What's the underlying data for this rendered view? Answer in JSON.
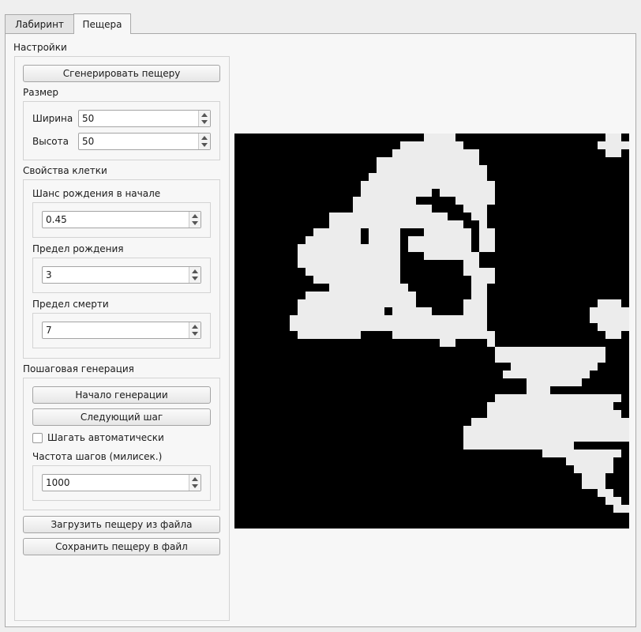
{
  "tabs": [
    {
      "label": "Лабиринт",
      "active": false
    },
    {
      "label": "Пещера",
      "active": true
    }
  ],
  "settings": {
    "title": "Настройки",
    "generate_button": "Сгенерировать пещеру",
    "size": {
      "title": "Размер",
      "width_label": "Ширина",
      "width_value": "50",
      "height_label": "Высота",
      "height_value": "50"
    },
    "cell_props": {
      "title": "Свойства клетки",
      "birth_chance_label": "Шанс рождения в начале",
      "birth_chance_value": "0.45",
      "birth_limit_label": "Предел рождения",
      "birth_limit_value": "3",
      "death_limit_label": "Предел смерти",
      "death_limit_value": "7"
    },
    "stepwise": {
      "title": "Пошаговая генерация",
      "start_button": "Начало генерации",
      "next_button": "Следующий шаг",
      "auto_label": "Шагать автоматически",
      "auto_checked": false,
      "freq_label": "Частота шагов (милисек.)",
      "freq_value": "1000"
    },
    "load_button": "Загрузить пещеру из файла",
    "save_button": "Сохранить пещеру в файл"
  },
  "cave": {
    "rows": 50,
    "cols": 50,
    "alive_color": "#ececec",
    "dead_color": "#000000",
    "grid": [
      "00000000000000000000000011110000000000000000000110",
      "00000000000000000000011111111000000000000000001111",
      "00000000000000000000111111111110000000000000000110",
      "00000000000000000011111111111110000000000000000000",
      "00000000000000000011111111111111000000000000000000",
      "00000000000000000111111111111111000000000000000000",
      "00000000000000001111111111111111100000000000000000",
      "00000000000000001111111110111111100000000000000000",
      "00000000000000011111111000001111100000000000000000",
      "00000000000000011111111110000111000000000000000000",
      "00000000000011111111111111100011000000000000000000",
      "00000000000011111111111111111001000000000000000000",
      "00000000001111110111100011111101100000000000000000",
      "00000000011111110111101111111101100000000000000000",
      "00000000111111111111101111111101100000000000000000",
      "00000000111111111111100011111110000000000000000000",
      "00000000111111111111100000000110000000000000000000",
      "00000000011111111111100000000111100000000000000000",
      "00000000001111111111100000000011100000000000000000",
      "00000000000011111111110000000011000000000000000000",
      "00000000011111111111111000000011000000000000000000",
      "00000000111111111111111000000111000000000000001110",
      "00000000111111111110111110000111000000000000011111",
      "00000001111111111111111111111111000000000000011111",
      "00000001111111111111111111111111000000000000001111",
      "00000000111111110000111111111111100000000000000110",
      "00000000000000000000000000110000100000000000000000",
      "00000000000000000000000000000000011111111111111000",
      "00000000000000000000000000000000011111111111111000",
      "00000000000000000000000000000000000111111111110000",
      "00000000000000000000000000000000001111111111100000",
      "00000000000000000000000000000000000001111111000000",
      "00000000000000000000000000000000000001110000000000",
      "00000000000000000000000000000000011111111111111110",
      "00000000000000000000000000000000111111111111111100",
      "00000000000000000000000000000000111111111111111110",
      "00000000000000000000000000000011111111111111111111",
      "00000000000000000000000000000111111111111111111111",
      "00000000000000000000000000000111111111111111111111",
      "00000000000000000000000000000111111111111110000000",
      "00000000000000000000000000000000000000011111111110",
      "00000000000000000000000000000000000000000011111100",
      "00000000000000000000000000000000000000000001111100",
      "00000000000000000000000000000000000000000000111000",
      "00000000000000000000000000000000000000000000111000",
      "00000000000000000000000000000000000000000000001100",
      "00000000000000000000000000000000000000000000000110",
      "00000000000000000000000000000000000000000000000011",
      "00000000000000000000000000000000000000000000000000",
      "00000000000000000000000000000000000000000000000000"
    ]
  }
}
